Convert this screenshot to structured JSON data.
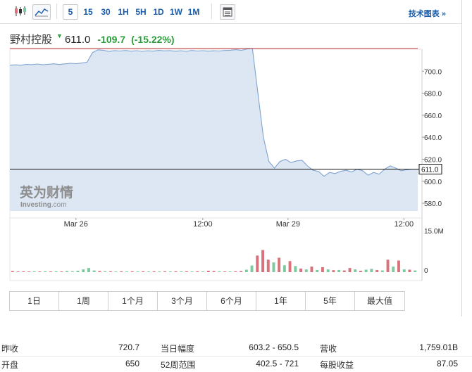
{
  "toolbar": {
    "timeframes": [
      "5",
      "15",
      "30",
      "1H",
      "5H",
      "1D",
      "1W",
      "1M"
    ],
    "active_timeframe": "5",
    "tech_chart_label": "技术图表 »"
  },
  "quote": {
    "name": "野村控股",
    "price": "611.0",
    "change": "-109.7",
    "change_pct": "(-15.22%)",
    "color_down": "#2a9d3a"
  },
  "watermark": {
    "brand_cn": "英为财情",
    "brand_en": "Investing",
    "brand_en_suffix": ".com"
  },
  "chart_data": {
    "type": "area",
    "title": "",
    "price_axis": {
      "ticks": [
        700.0,
        680.0,
        660.0,
        640.0,
        620.0,
        600.0,
        580.0
      ],
      "tick_labels": [
        "700.0",
        "680.0",
        "660.0",
        "640.0",
        "620.0",
        "600.0",
        "580.0"
      ],
      "ylim": [
        573,
        720
      ]
    },
    "current_price_label": "611.0",
    "current_price": 611.0,
    "prev_close": 720.7,
    "x_labels": [
      "Mar 26",
      "12:00",
      "Mar 29",
      "12:00"
    ],
    "price_series": [
      705.5,
      705.8,
      705.5,
      706.2,
      706.0,
      706.6,
      705.9,
      706.3,
      706.8,
      706.1,
      706.7,
      707.2,
      706.9,
      707.4,
      708.2,
      717.0,
      719.5,
      719.0,
      718.0,
      718.8,
      718.4,
      718.9,
      718.2,
      718.7,
      718.1,
      718.6,
      718.3,
      719.0,
      718.5,
      718.8,
      718.2,
      718.6,
      718.1,
      718.9,
      718.4,
      718.7,
      718.3,
      718.6,
      718.4,
      718.9,
      719.1,
      719.6,
      719.0,
      720.2,
      720.7,
      680.0,
      640.0,
      618.0,
      612.0,
      618.0,
      620.0,
      617.0,
      618.5,
      619.0,
      614.0,
      610.0,
      609.0,
      604.5,
      608.0,
      607.0,
      609.0,
      610.0,
      608.5,
      611.0,
      609.5,
      605.5,
      608.0,
      606.5,
      611.0,
      614.0,
      612.0,
      609.5,
      610.5,
      611.0,
      611.0
    ],
    "volume_axis": {
      "tick_labels": [
        "15.0M",
        "0"
      ],
      "ylim": [
        0,
        15.0
      ]
    },
    "volume_series": [
      0.4,
      0.2,
      0.3,
      0.2,
      0.3,
      0.2,
      0.3,
      0.2,
      0.3,
      0.2,
      0.4,
      0.3,
      0.5,
      1.0,
      1.5,
      0.6,
      0.4,
      0.3,
      0.3,
      0.2,
      0.3,
      0.2,
      0.3,
      0.2,
      0.3,
      0.2,
      0.3,
      0.2,
      0.3,
      0.2,
      0.3,
      0.2,
      0.3,
      0.2,
      0.3,
      0.2,
      0.5,
      0.4,
      0.3,
      0.2,
      0.2,
      0.3,
      0.4,
      0.9,
      2.4,
      6.0,
      8.0,
      4.5,
      3.5,
      5.2,
      2.5,
      4.0,
      2.2,
      1.3,
      1.0,
      2.0,
      0.8,
      1.8,
      1.0,
      0.7,
      0.8,
      0.6,
      1.5,
      1.0,
      0.5,
      0.9,
      1.2,
      0.8,
      0.6,
      4.5,
      2.0,
      4.2,
      1.0,
      0.9,
      0.6
    ],
    "volume_direction": [
      "d",
      "d",
      "d",
      "d",
      "u",
      "d",
      "u",
      "d",
      "u",
      "d",
      "u",
      "u",
      "u",
      "u",
      "u",
      "u",
      "d",
      "u",
      "d",
      "u",
      "d",
      "u",
      "d",
      "u",
      "d",
      "u",
      "d",
      "u",
      "d",
      "u",
      "d",
      "u",
      "d",
      "u",
      "d",
      "u",
      "d",
      "d",
      "u",
      "d",
      "u",
      "d",
      "d",
      "u",
      "u",
      "d",
      "d",
      "d",
      "u",
      "d",
      "u",
      "d",
      "u",
      "d",
      "u",
      "d",
      "u",
      "d",
      "u",
      "d",
      "u",
      "d",
      "d",
      "u",
      "d",
      "u",
      "u",
      "d",
      "u",
      "d",
      "u",
      "d",
      "u",
      "d",
      "u"
    ],
    "colors": {
      "line": "#7fa3d1",
      "area": "#dce7f3",
      "prev_close_line": "#c43a3a",
      "current_line": "#111111",
      "volume_up": "#7fc9a0",
      "volume_down": "#d9727a"
    }
  },
  "ranges": [
    "1日",
    "1周",
    "1个月",
    "3个月",
    "6个月",
    "1年",
    "5年",
    "最大值"
  ],
  "stats": [
    [
      {
        "label": "昨收",
        "value": "720.7"
      },
      {
        "label": "当日幅度",
        "value": "603.2 - 650.5"
      },
      {
        "label": "营收",
        "value": "1,759.01B"
      }
    ],
    [
      {
        "label": "开盘",
        "value": "650"
      },
      {
        "label": "52周范围",
        "value": "402.5 - 721"
      },
      {
        "label": "每股收益",
        "value": "87.05"
      }
    ]
  ]
}
